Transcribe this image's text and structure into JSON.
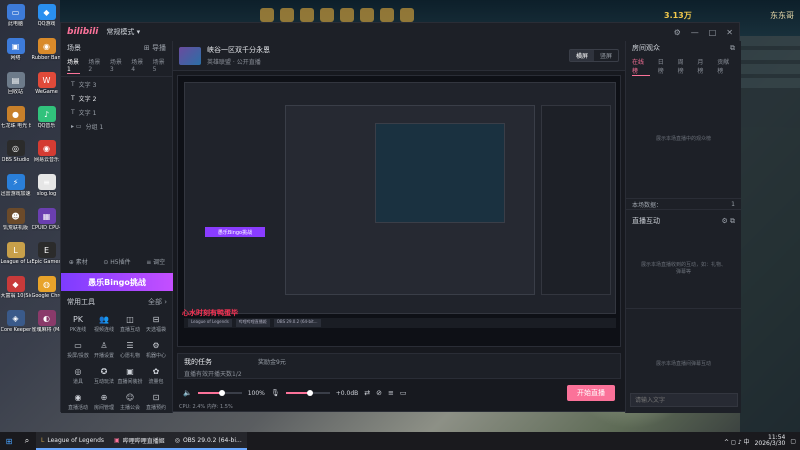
{
  "desktop": {
    "icons": [
      {
        "label": "此电脑",
        "color": "#3d7bd9",
        "glyph": "▭"
      },
      {
        "label": "QQ游戏",
        "color": "#2a8ff0",
        "glyph": "◆"
      },
      {
        "label": "网络",
        "color": "#3d7bd9",
        "glyph": "▣"
      },
      {
        "label": "Rubber Bandits",
        "color": "#d98a2a",
        "glyph": "◉"
      },
      {
        "label": "回收站",
        "color": "#6d7b8a",
        "glyph": "▤"
      },
      {
        "label": "WeGame",
        "color": "#e04a3a",
        "glyph": "W"
      },
      {
        "label": "七龙珠 电光 炸裂！ZERO",
        "color": "#c8802a",
        "glyph": "●"
      },
      {
        "label": "QQ音乐",
        "color": "#31c27c",
        "glyph": "♪"
      },
      {
        "label": "OBS Studio",
        "color": "#2b2b2b",
        "glyph": "◎"
      },
      {
        "label": "网易云音乐",
        "color": "#d43c33",
        "glyph": "◉"
      },
      {
        "label": "迅雷游戏加速器",
        "color": "#2a7fd9",
        "glyph": "⚡"
      },
      {
        "label": "slog.log",
        "color": "#e6e6e6",
        "glyph": "≡"
      },
      {
        "label": "饥荒联机版",
        "color": "#6b4a2a",
        "glyph": "☻"
      },
      {
        "label": "CPUID CPU-Z",
        "color": "#6a3fb0",
        "glyph": "▦"
      },
      {
        "label": "League of Legends",
        "color": "#c8a04a",
        "glyph": "L"
      },
      {
        "label": "Epic Games Launcher",
        "color": "#2b2b2b",
        "glyph": "E"
      },
      {
        "label": "大富翁 10(Sichen...",
        "color": "#c83a3a",
        "glyph": "◆"
      },
      {
        "label": "Google Chrome",
        "color": "#e8a32a",
        "glyph": "◍"
      },
      {
        "label": "Core Keeper 地...",
        "color": "#3a5a8a",
        "glyph": "◈"
      },
      {
        "label": "雀魂麻将 (Mahjong...",
        "color": "#8a3a6a",
        "glyph": "◐"
      }
    ]
  },
  "game": {
    "gold": "3.13万",
    "player": "东东哥"
  },
  "window": {
    "logo": "bilibili",
    "mode": "常规模式 ▾",
    "controls": [
      "⚙",
      "—",
      "□",
      "✕"
    ]
  },
  "left": {
    "scene_header": "场景",
    "import_label": "⊞ 导播",
    "scene_tabs": [
      "场景1",
      "场景2",
      "场景3",
      "场景4",
      "场景5"
    ],
    "sources": [
      {
        "icon": "T",
        "name": "文字 3"
      },
      {
        "icon": "T",
        "name": "文字 2"
      },
      {
        "icon": "T",
        "name": "文字 1"
      },
      {
        "icon": "▸ ▭",
        "name": "分组 1"
      }
    ],
    "footer": [
      "⊕ 素材",
      "⊙ H5插件",
      "≡ 调空"
    ],
    "promo": "愚乐Bingo挑战",
    "tools_header": "常用工具",
    "tools_more": "全部 ›",
    "tools": [
      {
        "icon": "PK",
        "label": "PK连线"
      },
      {
        "icon": "👥",
        "label": "视频连线"
      },
      {
        "icon": "◫",
        "label": "直播互动"
      },
      {
        "icon": "⊟",
        "label": "天选福袋"
      },
      {
        "icon": "▭",
        "label": "投屏/投放"
      },
      {
        "icon": "♙",
        "label": "开播设置"
      },
      {
        "icon": "☰",
        "label": "心愿礼物"
      },
      {
        "icon": "⚙",
        "label": "机器中心"
      },
      {
        "icon": "◎",
        "label": "道具"
      },
      {
        "icon": "✪",
        "label": "互动玩法"
      },
      {
        "icon": "▣",
        "label": "直播间装扮"
      },
      {
        "icon": "✿",
        "label": "流量包"
      },
      {
        "icon": "◉",
        "label": "直播活动"
      },
      {
        "icon": "⊕",
        "label": "房间管理"
      },
      {
        "icon": "☺",
        "label": "主播公会"
      },
      {
        "icon": "⊡",
        "label": "直播预约"
      }
    ]
  },
  "room": {
    "title": "峡谷一区双千分永恩",
    "category": "英雄联盟",
    "visibility": "公开直播",
    "orient_landscape": "横屏",
    "orient_portrait": "竖屏"
  },
  "preview": {
    "inner_promo": "愚乐Bingo挑战",
    "red_text": "心水时刻有鸭蛋毕",
    "taskbar_items": [
      "League of Legends",
      "哔哩哔哩直播姬",
      "OBS 29.0.2 (64-bit..."
    ]
  },
  "task": {
    "title": "我的任务",
    "reward": "奖励金9元",
    "desc": "直播有效开播天数1/2"
  },
  "audio": {
    "speaker_vol": "100%",
    "mic_vol": "+0.0dB",
    "speaker_level": 0.55,
    "mic_level": 0.55,
    "start_label": "开始直播"
  },
  "stats": {
    "cpu": "CPU: 2.4%",
    "mem": "内存: 1.5%"
  },
  "right": {
    "rank_header": "房间观众",
    "rank_tabs": [
      "在线榜",
      "日榜",
      "周榜",
      "月榜",
      "贡献榜"
    ],
    "rank_empty": "展示本场直播中的观众榜",
    "online_count_label": "本场数据：",
    "online_count": "1",
    "interact_header": "直播互动",
    "interact_empty": "展示本场直播收到的互动，如：礼物、弹幕等",
    "bottom_empty": "展示本场直播间弹幕互动",
    "chat_placeholder": "请输入文字",
    "accent": "#fb7299"
  },
  "taskbar": {
    "start_icon": "⊞",
    "search_icon": "⌕",
    "apps": [
      {
        "label": "League of Legends",
        "running": true
      },
      {
        "label": "哔哩哔哩直播姬",
        "running": true
      },
      {
        "label": "OBS 29.0.2 (64-bi...",
        "running": true
      }
    ],
    "tray_text": "^  ◻  ♪  中",
    "time": "11:54",
    "date": "2026/3/30"
  }
}
